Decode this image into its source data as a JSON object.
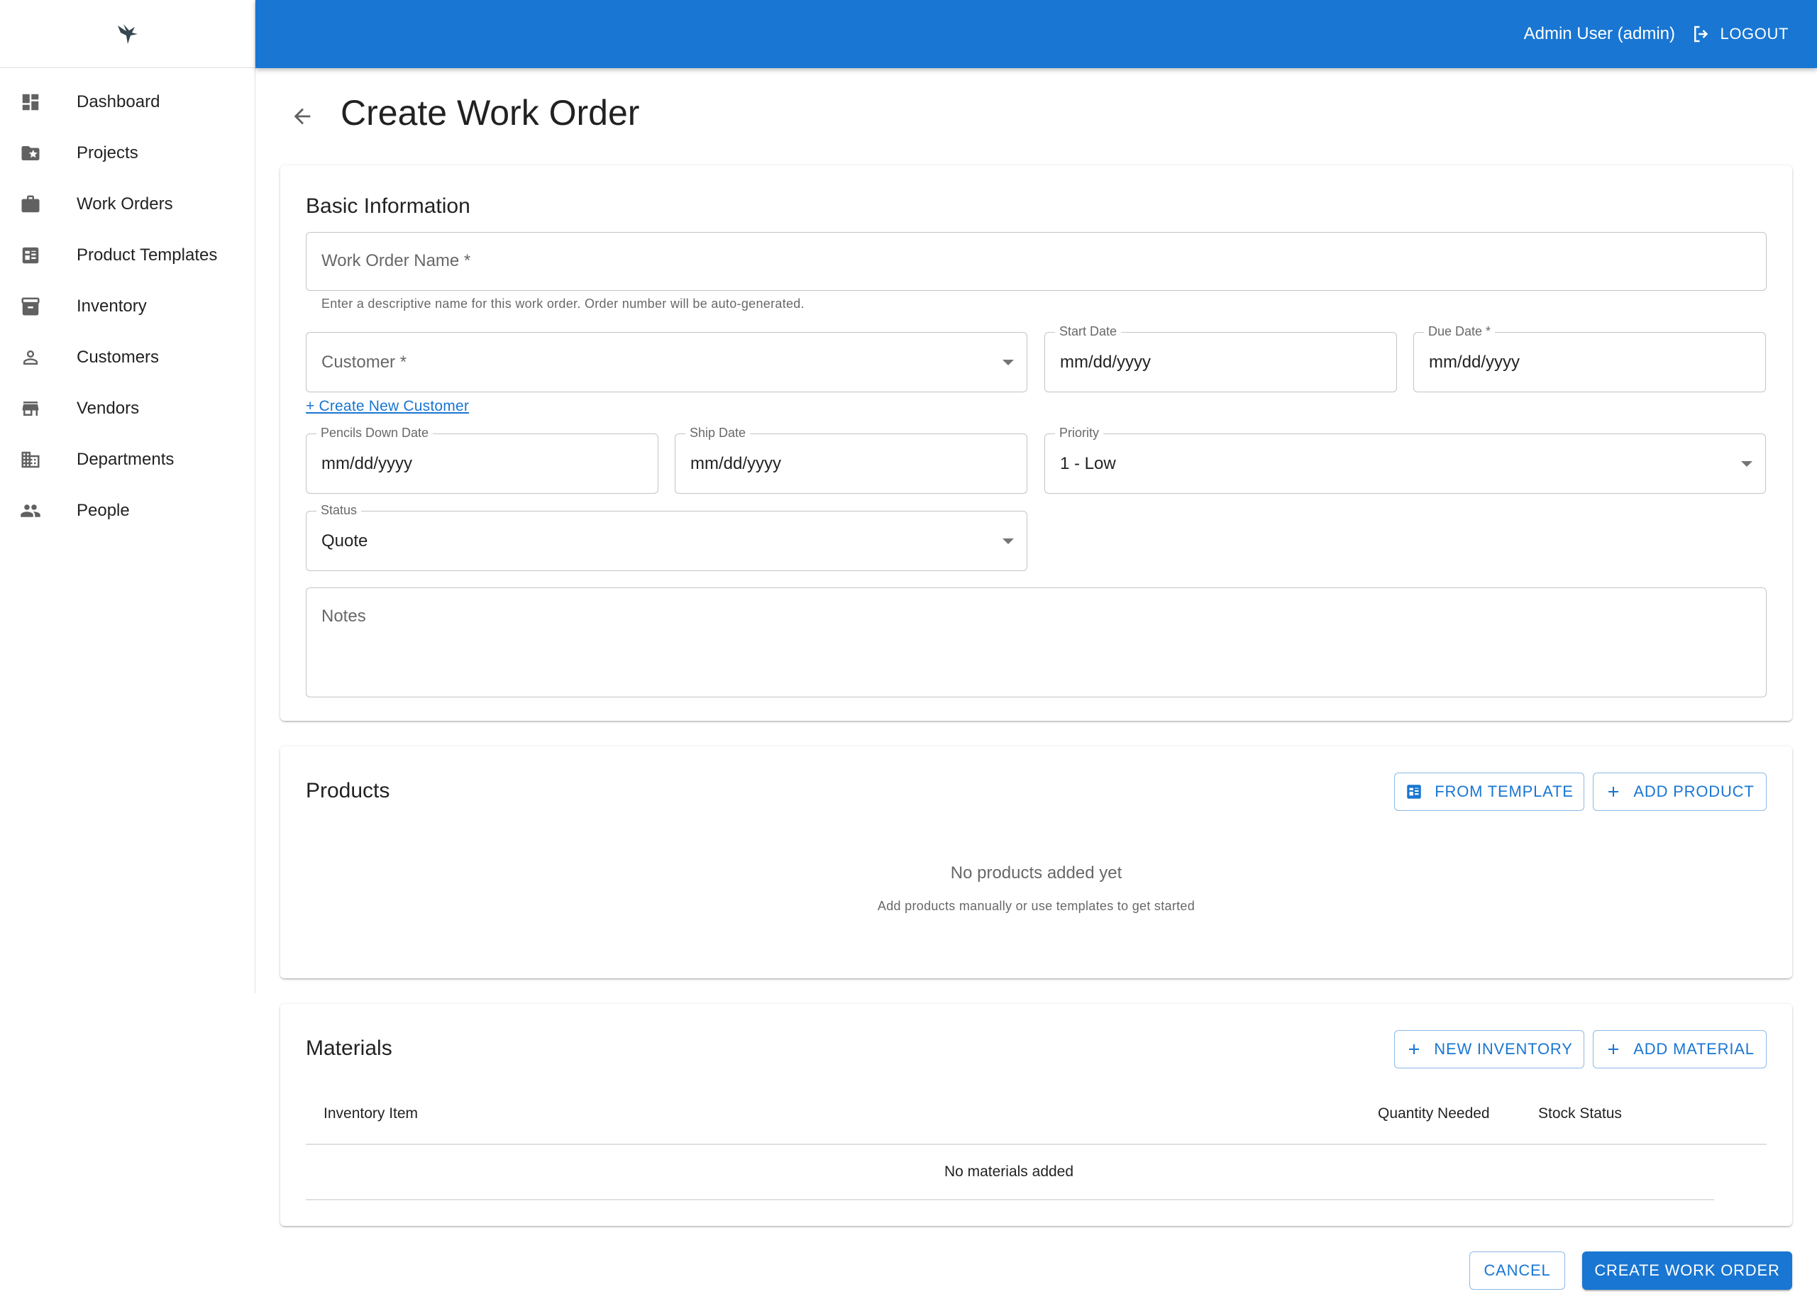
{
  "header": {
    "user_label": "Admin User (admin)",
    "logout_label": "LOGOUT"
  },
  "sidebar": {
    "items": [
      {
        "label": "Dashboard",
        "icon": "dashboard-icon"
      },
      {
        "label": "Projects",
        "icon": "folder-star-icon"
      },
      {
        "label": "Work Orders",
        "icon": "briefcase-icon"
      },
      {
        "label": "Product Templates",
        "icon": "template-list-icon"
      },
      {
        "label": "Inventory",
        "icon": "inventory-box-icon"
      },
      {
        "label": "Customers",
        "icon": "person-icon"
      },
      {
        "label": "Vendors",
        "icon": "storefront-icon"
      },
      {
        "label": "Departments",
        "icon": "building-icon"
      },
      {
        "label": "People",
        "icon": "people-icon"
      }
    ]
  },
  "page": {
    "title": "Create Work Order"
  },
  "basic_info": {
    "title": "Basic Information",
    "work_order_name": {
      "placeholder": "Work Order Name *",
      "helper": "Enter a descriptive name for this work order. Order number will be auto-generated."
    },
    "customer": {
      "placeholder": "Customer *"
    },
    "start_date": {
      "label": "Start Date",
      "value": "mm/dd/yyyy"
    },
    "due_date": {
      "label": "Due Date *",
      "value": "mm/dd/yyyy"
    },
    "create_customer_link": "+ Create New Customer",
    "pencils_down_date": {
      "label": "Pencils Down Date",
      "value": "mm/dd/yyyy"
    },
    "ship_date": {
      "label": "Ship Date",
      "value": "mm/dd/yyyy"
    },
    "priority": {
      "label": "Priority",
      "value": "1 - Low"
    },
    "status": {
      "label": "Status",
      "value": "Quote"
    },
    "notes": {
      "placeholder": "Notes"
    }
  },
  "products": {
    "title": "Products",
    "from_template_label": "FROM TEMPLATE",
    "add_product_label": "ADD PRODUCT",
    "empty_title": "No products added yet",
    "empty_subtitle": "Add products manually or use templates to get started"
  },
  "materials": {
    "title": "Materials",
    "new_inventory_label": "NEW INVENTORY",
    "add_material_label": "ADD MATERIAL",
    "columns": [
      "Inventory Item",
      "Quantity Needed",
      "Stock Status"
    ],
    "empty_text": "No materials added"
  },
  "footer": {
    "cancel_label": "CANCEL",
    "create_label": "CREATE WORK ORDER"
  },
  "colors": {
    "primary": "#1976d2",
    "icon_grey": "#616161"
  }
}
